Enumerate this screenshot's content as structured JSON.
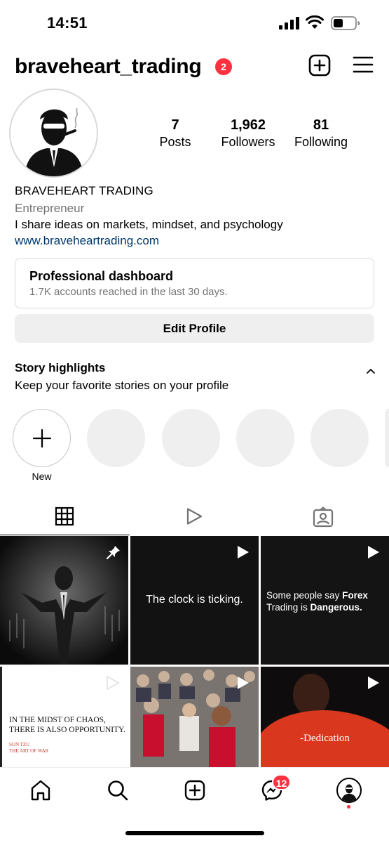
{
  "status_bar": {
    "time": "14:51"
  },
  "header": {
    "username": "braveheart_trading",
    "notification_count": "2"
  },
  "profile": {
    "stats": [
      {
        "value": "7",
        "label": "Posts"
      },
      {
        "value": "1,962",
        "label": "Followers"
      },
      {
        "value": "81",
        "label": "Following"
      }
    ],
    "display_name": "BRAVEHEART TRADING",
    "category": "Entrepreneur",
    "bio": "I share ideas on markets, mindset, and psychology",
    "link": "www.braveheartrading.com"
  },
  "dashboard": {
    "title": "Professional dashboard",
    "subtitle": "1.7K accounts reached in the last 30 days."
  },
  "edit_profile_label": "Edit Profile",
  "highlights": {
    "title": "Story highlights",
    "subtitle": "Keep your favorite stories on your profile",
    "new_label": "New"
  },
  "posts": [
    {
      "caption": "",
      "pinned": true,
      "reel": false
    },
    {
      "caption": "The clock is ticking.",
      "reel": true
    },
    {
      "caption_prefix": "Some people say ",
      "caption_bold1": "Forex",
      "caption_mid": "Trading is ",
      "caption_bold2": "Dangerous.",
      "reel": true
    },
    {
      "caption_line1": "IN THE MIDST OF CHAOS,",
      "caption_line2": "THERE IS ALSO OPPORTUNITY.",
      "author_line1": "SUN TZU",
      "author_line2": "THE ART OF WAR",
      "reel": true
    },
    {
      "caption": "",
      "reel": true
    },
    {
      "caption": "-Dedication",
      "reel": true
    }
  ],
  "bottom_nav": {
    "messages_badge": "12"
  },
  "colors": {
    "accent_red": "#ff3040",
    "link_blue": "#00376b",
    "muted_gray": "#737373",
    "button_gray": "#efefef"
  },
  "icons": [
    "signal-icon",
    "wifi-icon",
    "battery-icon",
    "new-post-icon",
    "menu-icon",
    "chevron-up-icon",
    "plus-icon",
    "grid-icon",
    "reels-icon",
    "tagged-icon",
    "pin-icon",
    "play-icon",
    "home-icon",
    "search-icon",
    "create-icon",
    "messenger-icon"
  ]
}
